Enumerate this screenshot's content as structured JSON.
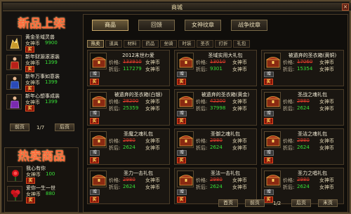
{
  "window": {
    "title": "商城",
    "close": "×"
  },
  "new_items": {
    "title": "新品上架",
    "items": [
      {
        "name": "黄金圣域灵兽",
        "currency": "女神币",
        "price": "9900",
        "buy": "买",
        "icon": "golden-beast-icon"
      },
      {
        "name": "新年财源滚滚装",
        "currency": "女神币",
        "price": "1399",
        "buy": "买",
        "icon": "red-outfit-icon"
      },
      {
        "name": "新年万事如意装",
        "currency": "女神币",
        "price": "1399",
        "buy": "买",
        "icon": "blue-outfit-icon"
      },
      {
        "name": "新年心想事成装",
        "currency": "女神币",
        "price": "1399",
        "buy": "买",
        "icon": "purple-outfit-icon"
      }
    ],
    "pager": {
      "prev": "前页",
      "page": "1/7",
      "next": "后页"
    }
  },
  "hot_items": {
    "title": "热卖商品",
    "items": [
      {
        "name": "我心有你",
        "currency": "女神币",
        "price": "100",
        "buy": "买",
        "icon": "rose-icon"
      },
      {
        "name": "爱你一生一世",
        "currency": "女神币",
        "price": "880",
        "buy": "买",
        "icon": "rose-bouquet-icon"
      }
    ]
  },
  "tabs": [
    {
      "label": "商品",
      "active": true
    },
    {
      "label": "回馈",
      "active": false
    },
    {
      "label": "女神纹章",
      "active": false
    },
    {
      "label": "战争纹章",
      "active": false
    }
  ],
  "subtabs": [
    {
      "label": "热卖",
      "active": true
    },
    {
      "label": "道具",
      "active": false
    },
    {
      "label": "材料",
      "active": false
    },
    {
      "label": "药品",
      "active": false
    },
    {
      "label": "坐骑",
      "active": false
    },
    {
      "label": "时装",
      "active": false
    },
    {
      "label": "圣衣",
      "active": false
    },
    {
      "label": "打折",
      "active": false
    },
    {
      "label": "礼包",
      "active": false
    }
  ],
  "labels": {
    "price": "价格:",
    "discount": "折后:",
    "currency": "女神币",
    "gift": "赠",
    "buy": "买"
  },
  "products": [
    {
      "name": "2012末世わ爱",
      "price": "133910",
      "discount": "117279"
    },
    {
      "name": "圣域实用大礼包",
      "price": "13010",
      "discount": "9301"
    },
    {
      "name": "被遗弃的圣衣箱(黄铜)",
      "price": "17060",
      "discount": "15354"
    },
    {
      "name": "被遗弃的圣衣箱(白银)",
      "price": "28200",
      "discount": "25359"
    },
    {
      "name": "被遗弃的圣衣箱(黄金)",
      "price": "42200",
      "discount": "37998"
    },
    {
      "name": "圣战之魂礼包",
      "price": "2980",
      "discount": "2624"
    },
    {
      "name": "圣魔之魂礼包",
      "price": "2980",
      "discount": "2624"
    },
    {
      "name": "圣御之魂礼包",
      "price": "2980",
      "discount": "2624"
    },
    {
      "name": "圣洁之魂礼包",
      "price": "2980",
      "discount": "2624"
    },
    {
      "name": "圣力一击礼包",
      "price": "2980",
      "discount": "2624"
    },
    {
      "name": "圣法一击礼包",
      "price": "2980",
      "discount": "2624"
    },
    {
      "name": "圣力之唱礼包",
      "price": "2980",
      "discount": "2624"
    }
  ],
  "pager": {
    "first": "首页",
    "prev": "前页",
    "page": "1/2",
    "next": "后页",
    "last": "末页"
  },
  "colors": {
    "title_orange": "#ff6a3c",
    "price_green": "#38e038",
    "strike_red": "#d83a2a",
    "border_gold": "#5a4a30"
  }
}
